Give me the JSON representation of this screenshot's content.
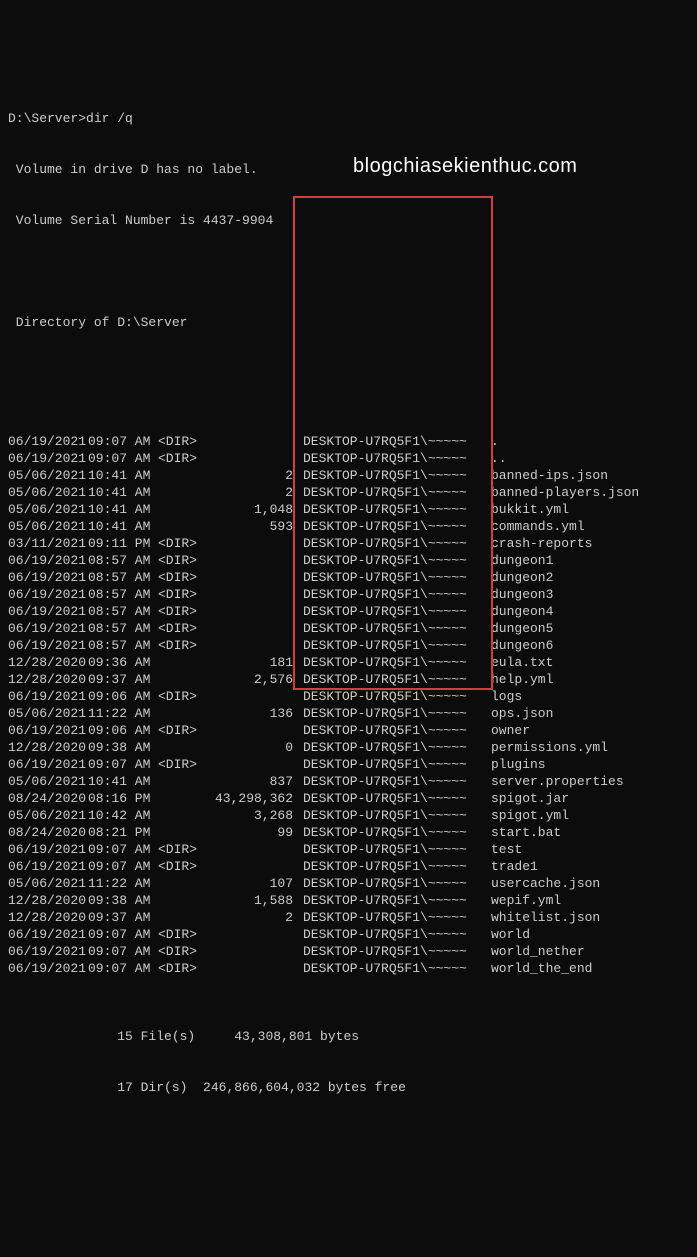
{
  "prompt": "D:\\Server>dir /q",
  "volume_label": " Volume in drive D has no label.",
  "volume_serial": " Volume Serial Number is 4437-9904",
  "directory_of": " Directory of D:\\Server",
  "watermark": "blogchiasekienthuc.com",
  "owner_text": "DESKTOP-U7RQ5F1\\~~~~~",
  "rows": [
    {
      "date": "06/19/2021",
      "time": "09:07 AM",
      "dir": "<DIR>",
      "size": "",
      "name": "."
    },
    {
      "date": "06/19/2021",
      "time": "09:07 AM",
      "dir": "<DIR>",
      "size": "",
      "name": ".."
    },
    {
      "date": "05/06/2021",
      "time": "10:41 AM",
      "dir": "",
      "size": "2",
      "name": "banned-ips.json"
    },
    {
      "date": "05/06/2021",
      "time": "10:41 AM",
      "dir": "",
      "size": "2",
      "name": "banned-players.json"
    },
    {
      "date": "05/06/2021",
      "time": "10:41 AM",
      "dir": "",
      "size": "1,048",
      "name": "bukkit.yml"
    },
    {
      "date": "05/06/2021",
      "time": "10:41 AM",
      "dir": "",
      "size": "593",
      "name": "commands.yml"
    },
    {
      "date": "03/11/2021",
      "time": "09:11 PM",
      "dir": "<DIR>",
      "size": "",
      "name": "crash-reports"
    },
    {
      "date": "06/19/2021",
      "time": "08:57 AM",
      "dir": "<DIR>",
      "size": "",
      "name": "dungeon1"
    },
    {
      "date": "06/19/2021",
      "time": "08:57 AM",
      "dir": "<DIR>",
      "size": "",
      "name": "dungeon2"
    },
    {
      "date": "06/19/2021",
      "time": "08:57 AM",
      "dir": "<DIR>",
      "size": "",
      "name": "dungeon3"
    },
    {
      "date": "06/19/2021",
      "time": "08:57 AM",
      "dir": "<DIR>",
      "size": "",
      "name": "dungeon4"
    },
    {
      "date": "06/19/2021",
      "time": "08:57 AM",
      "dir": "<DIR>",
      "size": "",
      "name": "dungeon5"
    },
    {
      "date": "06/19/2021",
      "time": "08:57 AM",
      "dir": "<DIR>",
      "size": "",
      "name": "dungeon6"
    },
    {
      "date": "12/28/2020",
      "time": "09:36 AM",
      "dir": "",
      "size": "181",
      "name": "eula.txt"
    },
    {
      "date": "12/28/2020",
      "time": "09:37 AM",
      "dir": "",
      "size": "2,576",
      "name": "help.yml"
    },
    {
      "date": "06/19/2021",
      "time": "09:06 AM",
      "dir": "<DIR>",
      "size": "",
      "name": "logs"
    },
    {
      "date": "05/06/2021",
      "time": "11:22 AM",
      "dir": "",
      "size": "136",
      "name": "ops.json"
    },
    {
      "date": "06/19/2021",
      "time": "09:06 AM",
      "dir": "<DIR>",
      "size": "",
      "name": "owner"
    },
    {
      "date": "12/28/2020",
      "time": "09:38 AM",
      "dir": "",
      "size": "0",
      "name": "permissions.yml"
    },
    {
      "date": "06/19/2021",
      "time": "09:07 AM",
      "dir": "<DIR>",
      "size": "",
      "name": "plugins"
    },
    {
      "date": "05/06/2021",
      "time": "10:41 AM",
      "dir": "",
      "size": "837",
      "name": "server.properties"
    },
    {
      "date": "08/24/2020",
      "time": "08:16 PM",
      "dir": "",
      "size": "43,298,362",
      "name": "spigot.jar"
    },
    {
      "date": "05/06/2021",
      "time": "10:42 AM",
      "dir": "",
      "size": "3,268",
      "name": "spigot.yml"
    },
    {
      "date": "08/24/2020",
      "time": "08:21 PM",
      "dir": "",
      "size": "99",
      "name": "start.bat"
    },
    {
      "date": "06/19/2021",
      "time": "09:07 AM",
      "dir": "<DIR>",
      "size": "",
      "name": "test"
    },
    {
      "date": "06/19/2021",
      "time": "09:07 AM",
      "dir": "<DIR>",
      "size": "",
      "name": "trade1"
    },
    {
      "date": "05/06/2021",
      "time": "11:22 AM",
      "dir": "",
      "size": "107",
      "name": "usercache.json"
    },
    {
      "date": "12/28/2020",
      "time": "09:38 AM",
      "dir": "",
      "size": "1,588",
      "name": "wepif.yml"
    },
    {
      "date": "12/28/2020",
      "time": "09:37 AM",
      "dir": "",
      "size": "2",
      "name": "whitelist.json"
    },
    {
      "date": "06/19/2021",
      "time": "09:07 AM",
      "dir": "<DIR>",
      "size": "",
      "name": "world"
    },
    {
      "date": "06/19/2021",
      "time": "09:07 AM",
      "dir": "<DIR>",
      "size": "",
      "name": "world_nether"
    },
    {
      "date": "06/19/2021",
      "time": "09:07 AM",
      "dir": "<DIR>",
      "size": "",
      "name": "world_the_end"
    }
  ],
  "summary": {
    "files": "              15 File(s)     43,308,801 bytes",
    "dirs": "              17 Dir(s)  246,866,604,032 bytes free"
  }
}
